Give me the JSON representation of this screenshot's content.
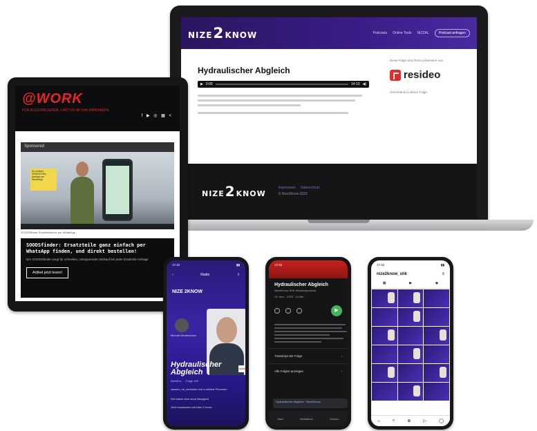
{
  "laptop": {
    "brand": {
      "left": "NIZE",
      "two": "2",
      "right": "KNOW"
    },
    "nav_links": [
      "Podcasts",
      "Online Tools",
      "NIZZAL"
    ],
    "nav_cta": "Podcast anfragen",
    "episode_title": "Hydraulischer Abgleich",
    "player_start": "0:00",
    "player_end": "14:13",
    "sponsor_intro": "Diese Folge wird Ihnen präsentiert von",
    "sponsor_name": "resideo",
    "sponsor_text": "Hörerlebnis in dieser Folge",
    "footer_links": [
      "Impressum",
      "Datenschutz"
    ],
    "footer_copy": "© Nize2know 2023"
  },
  "tablet": {
    "logo": "@WORK",
    "tagline": "FÜR AUSZUBILDENDE + AKTIVE IM SHK-HANDWERK",
    "icons": "f ▶ ◎ ▦ <",
    "sponsored_label": "Sponsored",
    "video_note": "So einfach ERSATZTEIL-Anfrage per WhatsApp",
    "video_caption": "SOODSfinder Ersatzteilsuche per WhatsApp",
    "promo_heading": "SOODSfinder: Ersatzteile ganz einfach per WhatsApp finden, und direkt bestellen!",
    "promo_text": "Der SOODSfinder sorgt für schnellen, zeitsparenden Einkauf bei jeder Ersatzteil-Anfrage",
    "promo_button": "Artikel jetzt lesen!"
  },
  "phone1": {
    "time": "17:42",
    "header": "Radio",
    "brand": "NIZE 2KNOW",
    "host": "Michael Mustermann",
    "title": "Hydraulischer Abgleich",
    "meta": "Nize2Kn... · Folge 139",
    "row1": "carsten_nb_sontheim und 4 weitere Personen",
    "row2": "Wir haben eine neue Neuigkeit",
    "row3": "Jetzt inzwischen hat Nize 2 Know",
    "badge": "resideo"
  },
  "phone2": {
    "time": "17:42",
    "title": "Hydraulischer Abgleich",
    "subtitle": "Nize2Know SHK-Wissenspodcast",
    "date": "15. Nov. · 2023 · 14 Min.",
    "play": "▶",
    "link1": "Transkript der Folge",
    "link2": "Alle Folgen anzeigen",
    "mini_player": "Hydraulischer Abgleich · Nize2Know",
    "tabs": [
      "Start",
      "Mediathek",
      "Suchen"
    ]
  },
  "phone3": {
    "time": "17:42",
    "account": "nize2know_shk",
    "tab_icons": [
      "▦",
      "▶",
      "◉"
    ],
    "nav_icons": [
      "⌂",
      "⌕",
      "⊕",
      "▷",
      "◯"
    ]
  },
  "colors": {
    "accent_purple": "#3b1c86",
    "work_red": "#e32727",
    "resideo_red": "#e62a2a",
    "play_green": "#3fb65c"
  }
}
